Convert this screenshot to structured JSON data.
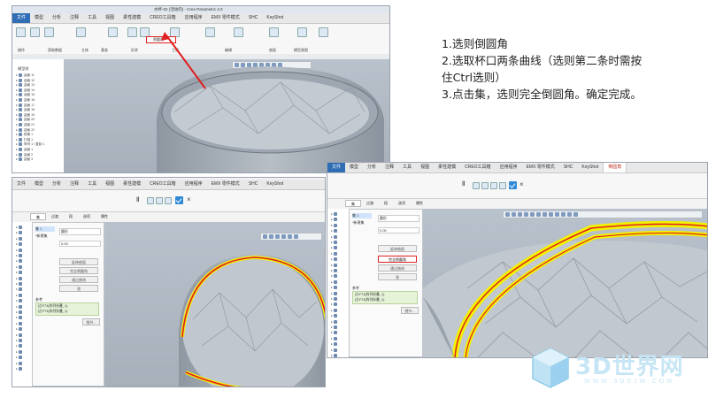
{
  "instructions": {
    "line1": "1.选则倒圆角",
    "line2": "2.选取杯口两条曲线（选则第二条时需按",
    "line3": "住Ctrl选则）",
    "line4": "3.点击集，选则完全倒圆角。确定完成。"
  },
  "screen1": {
    "title": "水杯-02 (活动的) - Creo Parametric 4.0",
    "tabs": [
      "文件",
      "模型",
      "分析",
      "注释",
      "工具",
      "视图",
      "柔性建模",
      "CREO工具箱",
      "应用程序",
      "EMX 零件模式",
      "SHC",
      "KeyShot"
    ],
    "groups": [
      "操作",
      "获取数据",
      "主体",
      "基准",
      "形状",
      "工程",
      "编辑",
      "曲面",
      "模型意图"
    ],
    "highlight_button": "倒圆角",
    "tree_header": "模型树",
    "tree_items": [
      "曲面 11",
      "曲面 12",
      "曲面 13",
      "曲面 14",
      "曲面 15",
      "曲面 16",
      "曲面 17",
      "曲面 18",
      "曲面 19",
      "曲面 20",
      "曲面 21",
      "曲面 22",
      "镜像 1",
      "扫描 1",
      "阵列 1 / 复制 1",
      "曲面 1",
      "曲面 2",
      "曲面 3"
    ]
  },
  "screen2": {
    "tabs": [
      "文件",
      "模型",
      "分析",
      "注释",
      "工具",
      "视图",
      "柔性建模",
      "CREO工具箱",
      "应用程序",
      "EMX 零件模式",
      "SHC",
      "KeyShot"
    ],
    "subtabs": [
      "集",
      "过渡",
      "段",
      "选项",
      "属性"
    ],
    "set_item": "集 1",
    "new_set": "*新建集",
    "type_label": "圆形",
    "radius_value": "0.00",
    "btn_chain": "延伸曲面",
    "btn_full_round": "完全倒圆角",
    "btn_through_curve": "通过曲线",
    "btn_chordal": "弦",
    "refs_label": "参考",
    "refs": [
      "边:F73(阵列折叠_1)",
      "边:F73(阵列折叠_1)"
    ],
    "details": "细节..."
  },
  "screen3": {
    "tabs": [
      "文件",
      "模型",
      "分析",
      "注释",
      "工具",
      "视图",
      "柔性建模",
      "CREO工具箱",
      "应用程序",
      "EMX 零件模式",
      "SHC",
      "KeyShot",
      "倒圆角"
    ],
    "subtabs": [
      "集",
      "过渡",
      "段",
      "选项",
      "属性"
    ],
    "set_item": "集 1",
    "new_set": "*新建集",
    "type_label": "圆形",
    "radius_value": "0.00",
    "btn_chain": "延伸曲面",
    "btn_full_round": "完全倒圆角",
    "btn_through_curve": "通过曲线",
    "btn_chordal": "弦",
    "refs_label": "参考",
    "refs": [
      "边:F73(阵列折叠_1)",
      "边:F73(阵列折叠_1)"
    ],
    "details": "细节..."
  },
  "watermark": {
    "brand": "3D世界网",
    "url": "WWW.3DSJW.COM"
  },
  "colors": {
    "ribbon_accent": "#2f6db5",
    "highlight_red": "#e02020",
    "edge_yellow": "#f2f200",
    "ok_blue": "#2f89d8"
  }
}
